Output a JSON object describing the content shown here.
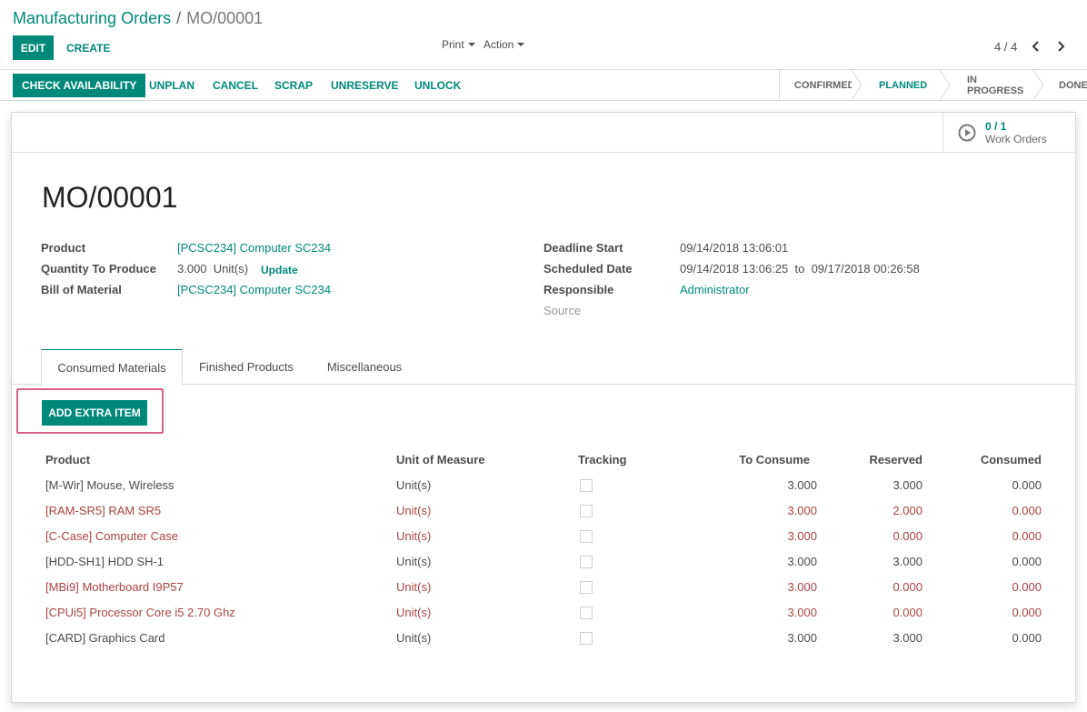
{
  "breadcrumb": {
    "parent": "Manufacturing Orders",
    "separator": "/",
    "current": "MO/00001"
  },
  "control": {
    "edit_label": "EDIT",
    "create_label": "CREATE",
    "print_label": "Print",
    "action_label": "Action",
    "pager_value": "4 / 4"
  },
  "statusbar": {
    "buttons": [
      "CHECK AVAILABILITY",
      "UNPLAN",
      "CANCEL",
      "SCRAP",
      "UNRESERVE",
      "UNLOCK"
    ],
    "stages": [
      "CONFIRMED",
      "PLANNED",
      "IN PROGRESS",
      "DONE"
    ],
    "active_stage": "PLANNED"
  },
  "work_orders": {
    "count": "0 / 1",
    "label": "Work Orders"
  },
  "form": {
    "title": "MO/00001",
    "left": [
      {
        "label": "Product",
        "value": "[PCSC234] Computer SC234"
      },
      {
        "label": "Quantity To Produce",
        "value": "3.000  Unit(s)",
        "action": "Update"
      },
      {
        "label": "Bill of Material",
        "value": "[PCSC234] Computer SC234"
      }
    ],
    "right": [
      {
        "label": "Deadline Start",
        "value": "09/14/2018 13:06:01"
      },
      {
        "label": "Scheduled Date",
        "value": "09/14/2018 13:06:25  to  09/17/2018 00:26:58"
      },
      {
        "label": "Responsible",
        "value": "Administrator"
      },
      {
        "label": "Source",
        "value": ""
      }
    ]
  },
  "tabs": [
    "Consumed Materials",
    "Finished Products",
    "Miscellaneous"
  ],
  "add_extra_label": "ADD EXTRA ITEM",
  "table": {
    "headers": [
      "Product",
      "Unit of Measure",
      "Tracking",
      "To Consume",
      "Reserved",
      "Consumed"
    ],
    "rows": [
      {
        "product": "[M-Wir] Mouse, Wireless",
        "uom": "Unit(s)",
        "to_consume": "3.000",
        "reserved": "3.000",
        "consumed": "0.000",
        "warn": false
      },
      {
        "product": "[RAM-SR5] RAM SR5",
        "uom": "Unit(s)",
        "to_consume": "3.000",
        "reserved": "2.000",
        "consumed": "0.000",
        "warn": true
      },
      {
        "product": "[C-Case] Computer Case",
        "uom": "Unit(s)",
        "to_consume": "3.000",
        "reserved": "0.000",
        "consumed": "0.000",
        "warn": true
      },
      {
        "product": "[HDD-SH1] HDD SH-1",
        "uom": "Unit(s)",
        "to_consume": "3.000",
        "reserved": "3.000",
        "consumed": "0.000",
        "warn": false
      },
      {
        "product": "[MBi9] Motherboard I9P57",
        "uom": "Unit(s)",
        "to_consume": "3.000",
        "reserved": "0.000",
        "consumed": "0.000",
        "warn": true
      },
      {
        "product": "[CPUi5] Processor Core i5 2.70 Ghz",
        "uom": "Unit(s)",
        "to_consume": "3.000",
        "reserved": "0.000",
        "consumed": "0.000",
        "warn": true
      },
      {
        "product": "[CARD] Graphics Card",
        "uom": "Unit(s)",
        "to_consume": "3.000",
        "reserved": "3.000",
        "consumed": "0.000",
        "warn": false
      }
    ]
  },
  "colors": {
    "primary": "#00897b",
    "warning": "#a94442",
    "highlight": "#d9608a"
  }
}
